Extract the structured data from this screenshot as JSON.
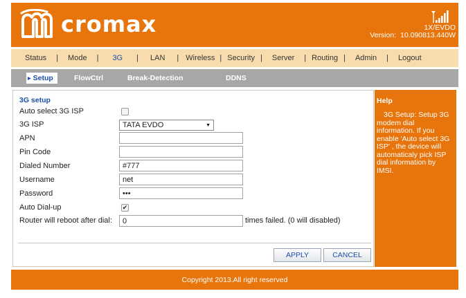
{
  "header": {
    "logo_text": "cromax",
    "network_type": "1X/EVDO",
    "version_label": "Version:",
    "version_value": "10.090813.440W"
  },
  "menu": [
    {
      "label": "Status"
    },
    {
      "label": "Mode"
    },
    {
      "label": "3G",
      "active": true
    },
    {
      "label": "LAN"
    },
    {
      "label": "Wireless"
    },
    {
      "label": "Security"
    },
    {
      "label": "Server"
    },
    {
      "label": "Routing"
    },
    {
      "label": "Admin"
    },
    {
      "label": "Logout"
    }
  ],
  "submenu": [
    {
      "label": "Setup",
      "active": true
    },
    {
      "label": "FlowCtrl"
    },
    {
      "label": "Break-Detection"
    },
    {
      "label": "DDNS"
    }
  ],
  "form": {
    "section_title": "3G setup",
    "auto_select_label": "Auto select 3G ISP",
    "auto_select_checked": false,
    "isp_label": "3G ISP",
    "isp_value": "TATA EVDO",
    "apn_label": "APN",
    "apn_value": "",
    "pin_label": "Pin Code",
    "pin_value": "",
    "dialed_label": "Dialed Number",
    "dialed_value": "#777",
    "username_label": "Username",
    "username_value": "net",
    "password_label": "Password",
    "password_value": "•••",
    "auto_dial_label": "Auto Dial-up",
    "auto_dial_checked": true,
    "reboot_label": "Router will reboot after dial:",
    "reboot_value": "0",
    "reboot_suffix": "times failed. (0 will disabled)",
    "apply_label": "APPLY",
    "cancel_label": "CANCEL"
  },
  "help": {
    "title": "Help",
    "text": "3G Setup: Setup 3G modem dial information. If you enable 'Auto select 3G ISP' , the device will automaticaly pick ISP dial information by IMSI."
  },
  "footer": {
    "copyright": "Copyright 2013.All right reserved"
  },
  "colors": {
    "brand_orange": "#e8740c",
    "menu_bg": "#f9dcae",
    "submenu_bg": "#a7a7a7",
    "link_blue": "#1b4fa8"
  }
}
